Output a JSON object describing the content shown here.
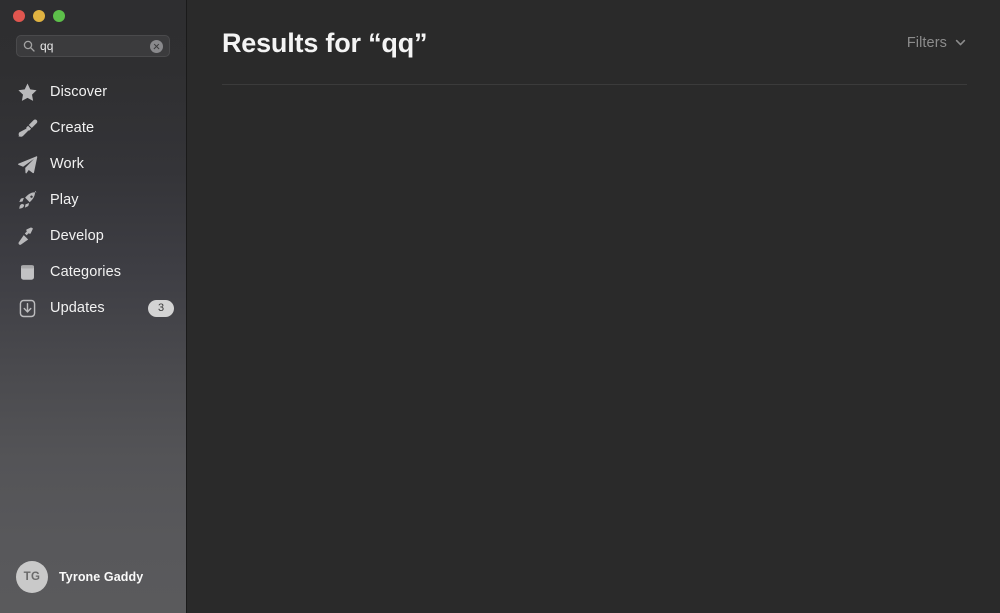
{
  "window": {
    "traffic_lights": [
      {
        "name": "close",
        "color": "#e0564f"
      },
      {
        "name": "minimize",
        "color": "#e0b341"
      },
      {
        "name": "zoom",
        "color": "#5dc04a"
      }
    ]
  },
  "sidebar": {
    "search": {
      "icon": "search-icon",
      "value": "qq",
      "placeholder": "Search",
      "clear_icon": "clear-icon"
    },
    "items": [
      {
        "label": "Discover",
        "icon": "star-icon",
        "badge": null
      },
      {
        "label": "Create",
        "icon": "paintbrush-icon",
        "badge": null
      },
      {
        "label": "Work",
        "icon": "paper-plane-icon",
        "badge": null
      },
      {
        "label": "Play",
        "icon": "rocket-icon",
        "badge": null
      },
      {
        "label": "Develop",
        "icon": "hammer-icon",
        "badge": null
      },
      {
        "label": "Categories",
        "icon": "grid-icon",
        "badge": null
      },
      {
        "label": "Updates",
        "icon": "download-icon",
        "badge": "3"
      }
    ],
    "account": {
      "initials": "TG",
      "name": "Tyrone Gaddy"
    }
  },
  "main": {
    "title": "Results for “qq”",
    "filters": {
      "label": "Filters",
      "icon": "chevron-down-icon"
    },
    "results": []
  },
  "colors": {
    "sidebar_top": "#2e2e30",
    "sidebar_bottom": "#5a5a5c",
    "content_bg": "#2a2a2a",
    "divider": "#3b3b3b",
    "text_primary": "#f4f4f4",
    "text_muted": "#8c8c8c",
    "badge_bg": "#d3d3d3"
  }
}
